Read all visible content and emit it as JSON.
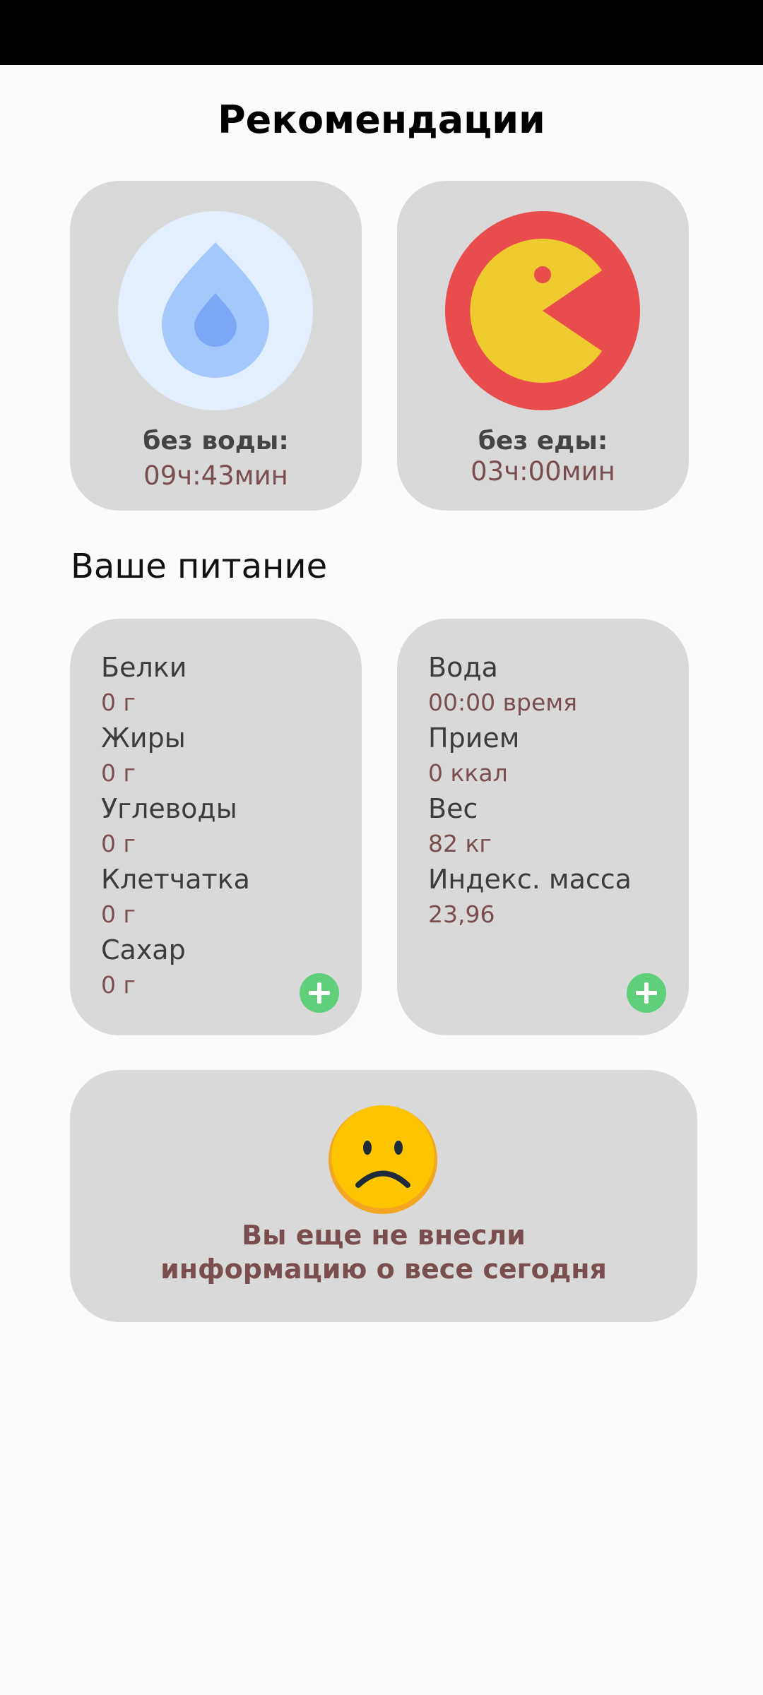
{
  "header": {
    "title": "Рекомендации"
  },
  "recommendations": {
    "water": {
      "label": "без воды:",
      "value": "09ч:43мин",
      "icon": "water-drop-icon"
    },
    "food": {
      "label": "без еды:",
      "value": "03ч:00мин",
      "icon": "pacman-food-icon"
    }
  },
  "nutrition": {
    "section_title": "Ваше питание",
    "nutrients": [
      {
        "name": "Белки",
        "value": "0 г"
      },
      {
        "name": "Жиры",
        "value": "0 г"
      },
      {
        "name": "Углеводы",
        "value": "0 г"
      },
      {
        "name": "Клетчатка",
        "value": "0 г"
      },
      {
        "name": "Сахар",
        "value": "0 г"
      }
    ],
    "stats": [
      {
        "name": "Вода",
        "value": "00:00 время"
      },
      {
        "name": "Прием",
        "value": "0 ккал"
      },
      {
        "name": "Вес",
        "value": "82 кг"
      },
      {
        "name": "Индекс. масса",
        "value": "23,96"
      }
    ]
  },
  "weight_notice": {
    "line1": "Вы еще не внесли",
    "line2": "информацию о весе сегодня",
    "icon": "sad-face-icon"
  },
  "colors": {
    "card_bg": "#d9d9d9",
    "value_text": "#7a4e4e",
    "add_button": "#5fcf7a",
    "water_drop": "#a3c8fb",
    "food_circle": "#e84c4d",
    "pacman": "#efcb2f"
  }
}
